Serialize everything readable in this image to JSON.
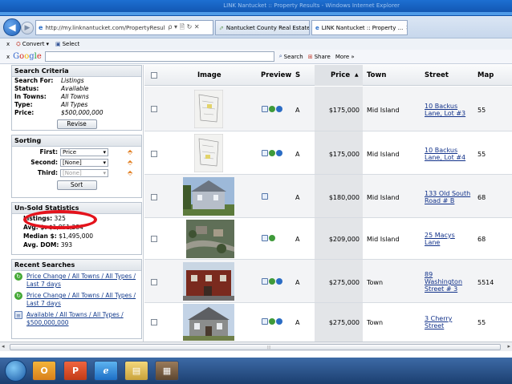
{
  "browser": {
    "url": "http://my.linknantucket.com/PropertyResults.a",
    "url_icons": "ρ ▾ 🗎 ↻ ✕",
    "tabs": [
      {
        "label": "Nantucket County Real Estate ..."
      },
      {
        "label": "LINK Nantucket :: Property ...",
        "close": "✕"
      }
    ],
    "ghost_title": "LINK Nantucket :: Property Results - Windows Internet Explorer"
  },
  "toolbar": {
    "close_x": "x",
    "convert_label": "Convert",
    "convert_arrow": "▾",
    "select_label": "Select",
    "google_label": "Google",
    "search_label": "Search",
    "share_label": "Share",
    "more_label": "More »"
  },
  "sidebar": {
    "criteria": {
      "title": "Search Criteria",
      "rows": [
        {
          "k": "Search For:",
          "v": "Listings"
        },
        {
          "k": "Status:",
          "v": "Available"
        },
        {
          "k": "In Towns:",
          "v": "All Towns"
        },
        {
          "k": "Type:",
          "v": "All Types"
        },
        {
          "k": "Price:",
          "v": "$500,000,000"
        }
      ],
      "button": "Revise"
    },
    "sorting": {
      "title": "Sorting",
      "rows": [
        {
          "k": "First:",
          "v": "Price"
        },
        {
          "k": "Second:",
          "v": "[None]"
        },
        {
          "k": "Third:",
          "v": "[None]"
        }
      ],
      "button": "Sort"
    },
    "stats": {
      "title": "Un-Sold Statistics",
      "rows": [
        {
          "k": "Listings:",
          "v": "325"
        },
        {
          "k": "Avg. $:",
          "v": "$1,851,284"
        },
        {
          "k": "Median $:",
          "v": "$1,495,000"
        },
        {
          "k": "Avg. DOM:",
          "v": "393"
        }
      ]
    },
    "recent": {
      "title": "Recent Searches",
      "items": [
        {
          "label": "Price Change / All Towns / All Types / Last 7 days"
        },
        {
          "label": "Price Change / All Towns / All Types / Last 7 days"
        },
        {
          "label": "Available / All Towns / All Types / $500,000,000"
        }
      ]
    }
  },
  "table": {
    "headers": {
      "image": "Image",
      "preview": "Preview",
      "s": "S",
      "price": "Price",
      "price_sort": "▲",
      "town": "Town",
      "street": "Street",
      "map": "Map"
    },
    "rows": [
      {
        "price": "$175,000",
        "town": "Mid Island",
        "street_1": "10 Backus",
        "street_2": "Lane, Lot #3",
        "street_3": "",
        "map": "55",
        "status": "A"
      },
      {
        "price": "$175,000",
        "town": "Mid Island",
        "street_1": "10 Backus",
        "street_2": "Lane, Lot #4",
        "street_3": "",
        "map": "55",
        "status": "A"
      },
      {
        "price": "$180,000",
        "town": "Mid Island",
        "street_1": "133 Old South",
        "street_2": "Road # B",
        "street_3": "",
        "map": "68",
        "status": "A"
      },
      {
        "price": "$209,000",
        "town": "Mid Island",
        "street_1": "25 Macys",
        "street_2": "Lane",
        "street_3": "",
        "map": "68",
        "status": "A"
      },
      {
        "price": "$275,000",
        "town": "Town",
        "street_1": "89",
        "street_2": "Washington",
        "street_3": "Street # 3",
        "map": "5514",
        "status": "A"
      },
      {
        "price": "$275,000",
        "town": "Town",
        "street_1": "3 Cherry",
        "street_2": "Street",
        "street_3": "",
        "map": "55",
        "status": "A"
      }
    ]
  },
  "taskbar": {
    "icons": [
      {
        "name": "outlook-icon",
        "glyph": "O"
      },
      {
        "name": "powerpoint-icon",
        "glyph": "P"
      },
      {
        "name": "internet-explorer-icon",
        "glyph": "e"
      },
      {
        "name": "file-explorer-icon",
        "glyph": "▤"
      },
      {
        "name": "app-icon",
        "glyph": "▦"
      }
    ]
  },
  "colors": {
    "annotation": "#e4131c",
    "link": "#12328a",
    "taskbar": "#2a5288"
  }
}
